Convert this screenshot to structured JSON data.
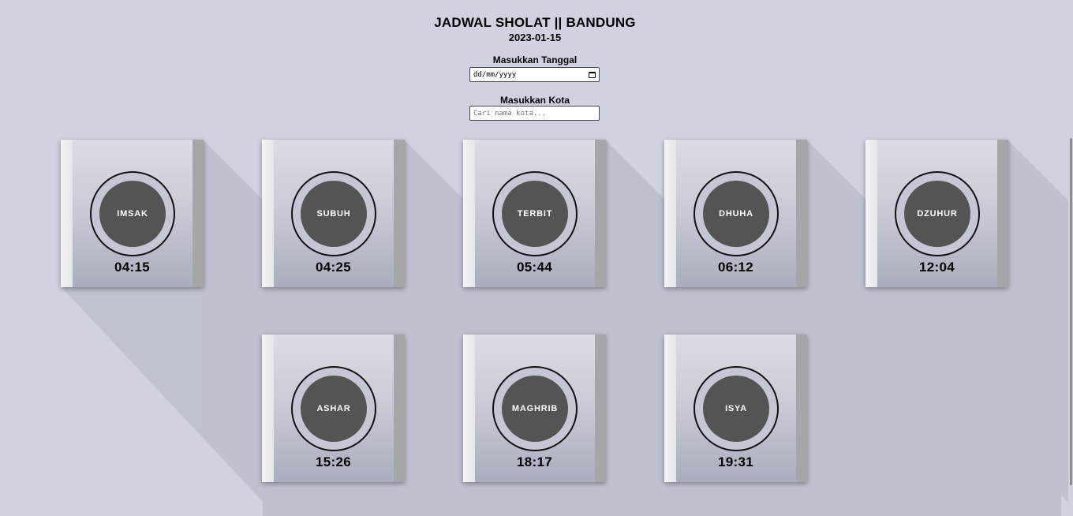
{
  "header": {
    "title": "JADWAL SHOLAT || BANDUNG",
    "date": "2023-01-15"
  },
  "form": {
    "date_label": "Masukkan Tanggal",
    "date_placeholder": "dd/mm/yyyy",
    "city_label": "Masukkan Kota",
    "city_placeholder": "Cari nama kota..."
  },
  "prayers": [
    {
      "name": "IMSAK",
      "time": "04:15"
    },
    {
      "name": "SUBUH",
      "time": "04:25"
    },
    {
      "name": "TERBIT",
      "time": "05:44"
    },
    {
      "name": "DHUHA",
      "time": "06:12"
    },
    {
      "name": "DZUHUR",
      "time": "12:04"
    },
    {
      "name": "ASHAR",
      "time": "15:26"
    },
    {
      "name": "MAGHRIB",
      "time": "18:17"
    },
    {
      "name": "ISYA",
      "time": "19:31"
    }
  ],
  "colors": {
    "background": "#d1d2e1",
    "disc": "#545454",
    "card_edge": "#a6a6a8"
  },
  "icons": {
    "date_picker": "calendar-icon"
  }
}
